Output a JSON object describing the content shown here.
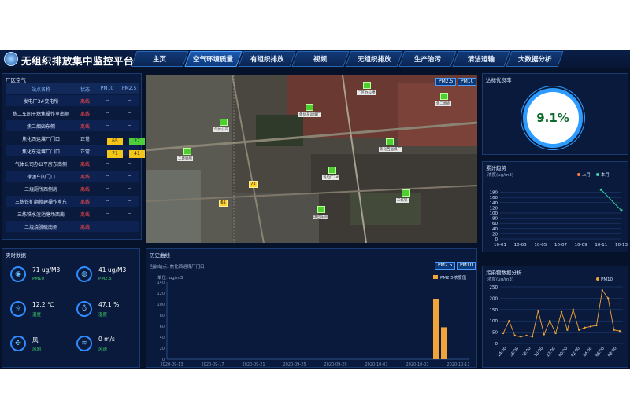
{
  "header": {
    "title": "无组织排放集中监控平台",
    "nav": [
      {
        "label": "主页",
        "active": false
      },
      {
        "label": "空气环境质量",
        "active": true
      },
      {
        "label": "有组织排放",
        "active": false
      },
      {
        "label": "视频",
        "active": false
      },
      {
        "label": "无组织排放",
        "active": false
      },
      {
        "label": "生产治污",
        "active": false
      },
      {
        "label": "清洁运输",
        "active": false
      },
      {
        "label": "大数据分析",
        "active": false
      }
    ]
  },
  "stations": {
    "title": "厂区空气",
    "columns": [
      "站点名称",
      "状态",
      "PM10",
      "PM2.5"
    ],
    "rows": [
      {
        "name": "发电厂3#变电所",
        "status": "离线",
        "pm10": "--",
        "pm25": "--"
      },
      {
        "name": "炼二车间干熄焦操作室南侧",
        "status": "离线",
        "pm10": "--",
        "pm25": "--"
      },
      {
        "name": "焦二烟囱东侧",
        "status": "离线",
        "pm10": "--",
        "pm25": "--"
      },
      {
        "name": "焦化西运煤厂门口",
        "status": "正常",
        "pm10": "65",
        "pm25": "27"
      },
      {
        "name": "焦化东运煤厂门口",
        "status": "正常",
        "pm10": "71",
        "pm25": "41"
      },
      {
        "name": "气体公司办公平房东南侧",
        "status": "离线",
        "pm10": "--",
        "pm25": "--"
      },
      {
        "name": "球团车间门口",
        "status": "离线",
        "pm10": "--",
        "pm25": "--"
      },
      {
        "name": "二烧厕所西侧房",
        "status": "离线",
        "pm10": "--",
        "pm25": "--"
      },
      {
        "name": "三炼铁扩翻修建操作室东",
        "status": "离线",
        "pm10": "--",
        "pm25": "--"
      },
      {
        "name": "三炼铁水渣池塘场西南",
        "status": "离线",
        "pm10": "--",
        "pm25": "--"
      },
      {
        "name": "二烧烧脱硫南侧",
        "status": "离线",
        "pm10": "--",
        "pm25": "--"
      }
    ]
  },
  "map": {
    "buttons": [
      "PM2.5",
      "PM10"
    ],
    "markers": [
      {
        "label": "厂区办公楼",
        "warn": false,
        "value": ""
      },
      {
        "label": "焦化东运煤厂",
        "warn": false,
        "value": ""
      },
      {
        "label": "焦二烟囱",
        "warn": false,
        "value": ""
      },
      {
        "label": "气体公司",
        "warn": false,
        "value": ""
      },
      {
        "label": "焦化西运煤厂",
        "warn": false,
        "value": ""
      },
      {
        "label": "二烧厕所",
        "warn": false,
        "value": ""
      },
      {
        "label": "发电厂3#",
        "warn": false,
        "value": ""
      },
      {
        "label": "三炼铁",
        "warn": false,
        "value": ""
      },
      {
        "label": "球团车间",
        "warn": false,
        "value": ""
      },
      {
        "label": "",
        "warn": true,
        "value": "65"
      },
      {
        "label": "",
        "warn": true,
        "value": "72"
      }
    ]
  },
  "rate": {
    "title": "达标优良率",
    "value": "9.1%"
  },
  "trend": {
    "title": "累计趋势",
    "unit": "浓度(ug/m3)",
    "legend": [
      "上月",
      "本月"
    ],
    "colors": [
      "#ff7a45",
      "#2fd6a3"
    ]
  },
  "realtime": {
    "title": "实时数据",
    "items": [
      {
        "icon": "pm10-icon",
        "glyph": "◉",
        "value": "71 ug/M3",
        "label": "PM10"
      },
      {
        "icon": "pm25-icon",
        "glyph": "◍",
        "value": "41 ug/M3",
        "label": "PM2.5"
      },
      {
        "icon": "temperature-icon",
        "glyph": "☼",
        "value": "12.2 ℃",
        "label": "温度"
      },
      {
        "icon": "humidity-icon",
        "glyph": "♁",
        "value": "47.1 %",
        "label": "湿度"
      },
      {
        "icon": "wind-direction-icon",
        "glyph": "✣",
        "value": "风",
        "label": "风向"
      },
      {
        "icon": "wind-speed-icon",
        "glyph": "≋",
        "value": "0 m/s",
        "label": "风速"
      }
    ]
  },
  "history": {
    "title": "历史曲线",
    "station_label": "当前站点: 焦化西运煤厂门口",
    "unit": "单位: ug/m3",
    "buttons": [
      "PM2.5",
      "PM10"
    ],
    "legend": "PM2.5浓度值"
  },
  "pollution": {
    "title": "污染物数据分析",
    "unit": "浓度(ug/m3)",
    "legend": "PM10"
  },
  "chart_data": [
    {
      "type": "line",
      "title": "累计趋势",
      "ylabel": "浓度(ug/m3)",
      "x": [
        "10-01",
        "10-03",
        "10-05",
        "10-07",
        "10-09",
        "10-11",
        "10-13"
      ],
      "ylim": [
        0,
        200
      ],
      "yticks": [
        0,
        20,
        40,
        60,
        80,
        100,
        120,
        140,
        160,
        180
      ],
      "series": [
        {
          "name": "上月",
          "values": [
            null,
            null,
            null,
            null,
            null,
            null,
            null
          ]
        },
        {
          "name": "本月",
          "values": [
            null,
            null,
            null,
            null,
            null,
            190,
            110
          ]
        }
      ]
    },
    {
      "type": "bar",
      "title": "历史曲线",
      "ylabel": "单位: ug/m3",
      "categories": [
        "2020-09-13",
        "2020-09-17",
        "2020-09-21",
        "2020-09-25",
        "2020-09-29",
        "2020-10-03",
        "2020-10-07",
        "2020-10-11"
      ],
      "ylim": [
        0,
        140
      ],
      "yticks": [
        0,
        20,
        40,
        60,
        80,
        100,
        120,
        140
      ],
      "series": [
        {
          "name": "PM2.5浓度值",
          "values": [
            0,
            0,
            0,
            0,
            0,
            0,
            0,
            110,
            58
          ]
        }
      ]
    },
    {
      "type": "line",
      "title": "污染物数据分析",
      "ylabel": "浓度(ug/m3)",
      "x": [
        "14:00",
        "16:00",
        "18:00",
        "20:00",
        "22:00",
        "00:00",
        "02:00",
        "04:00",
        "06:00",
        "08:00"
      ],
      "ylim": [
        0,
        250
      ],
      "yticks": [
        0,
        50,
        100,
        150,
        200,
        250
      ],
      "series": [
        {
          "name": "PM10",
          "values": [
            45,
            100,
            35,
            30,
            35,
            30,
            145,
            40,
            100,
            45,
            140,
            60,
            150,
            60,
            70,
            75,
            80,
            235,
            200,
            60,
            55
          ]
        }
      ]
    }
  ]
}
